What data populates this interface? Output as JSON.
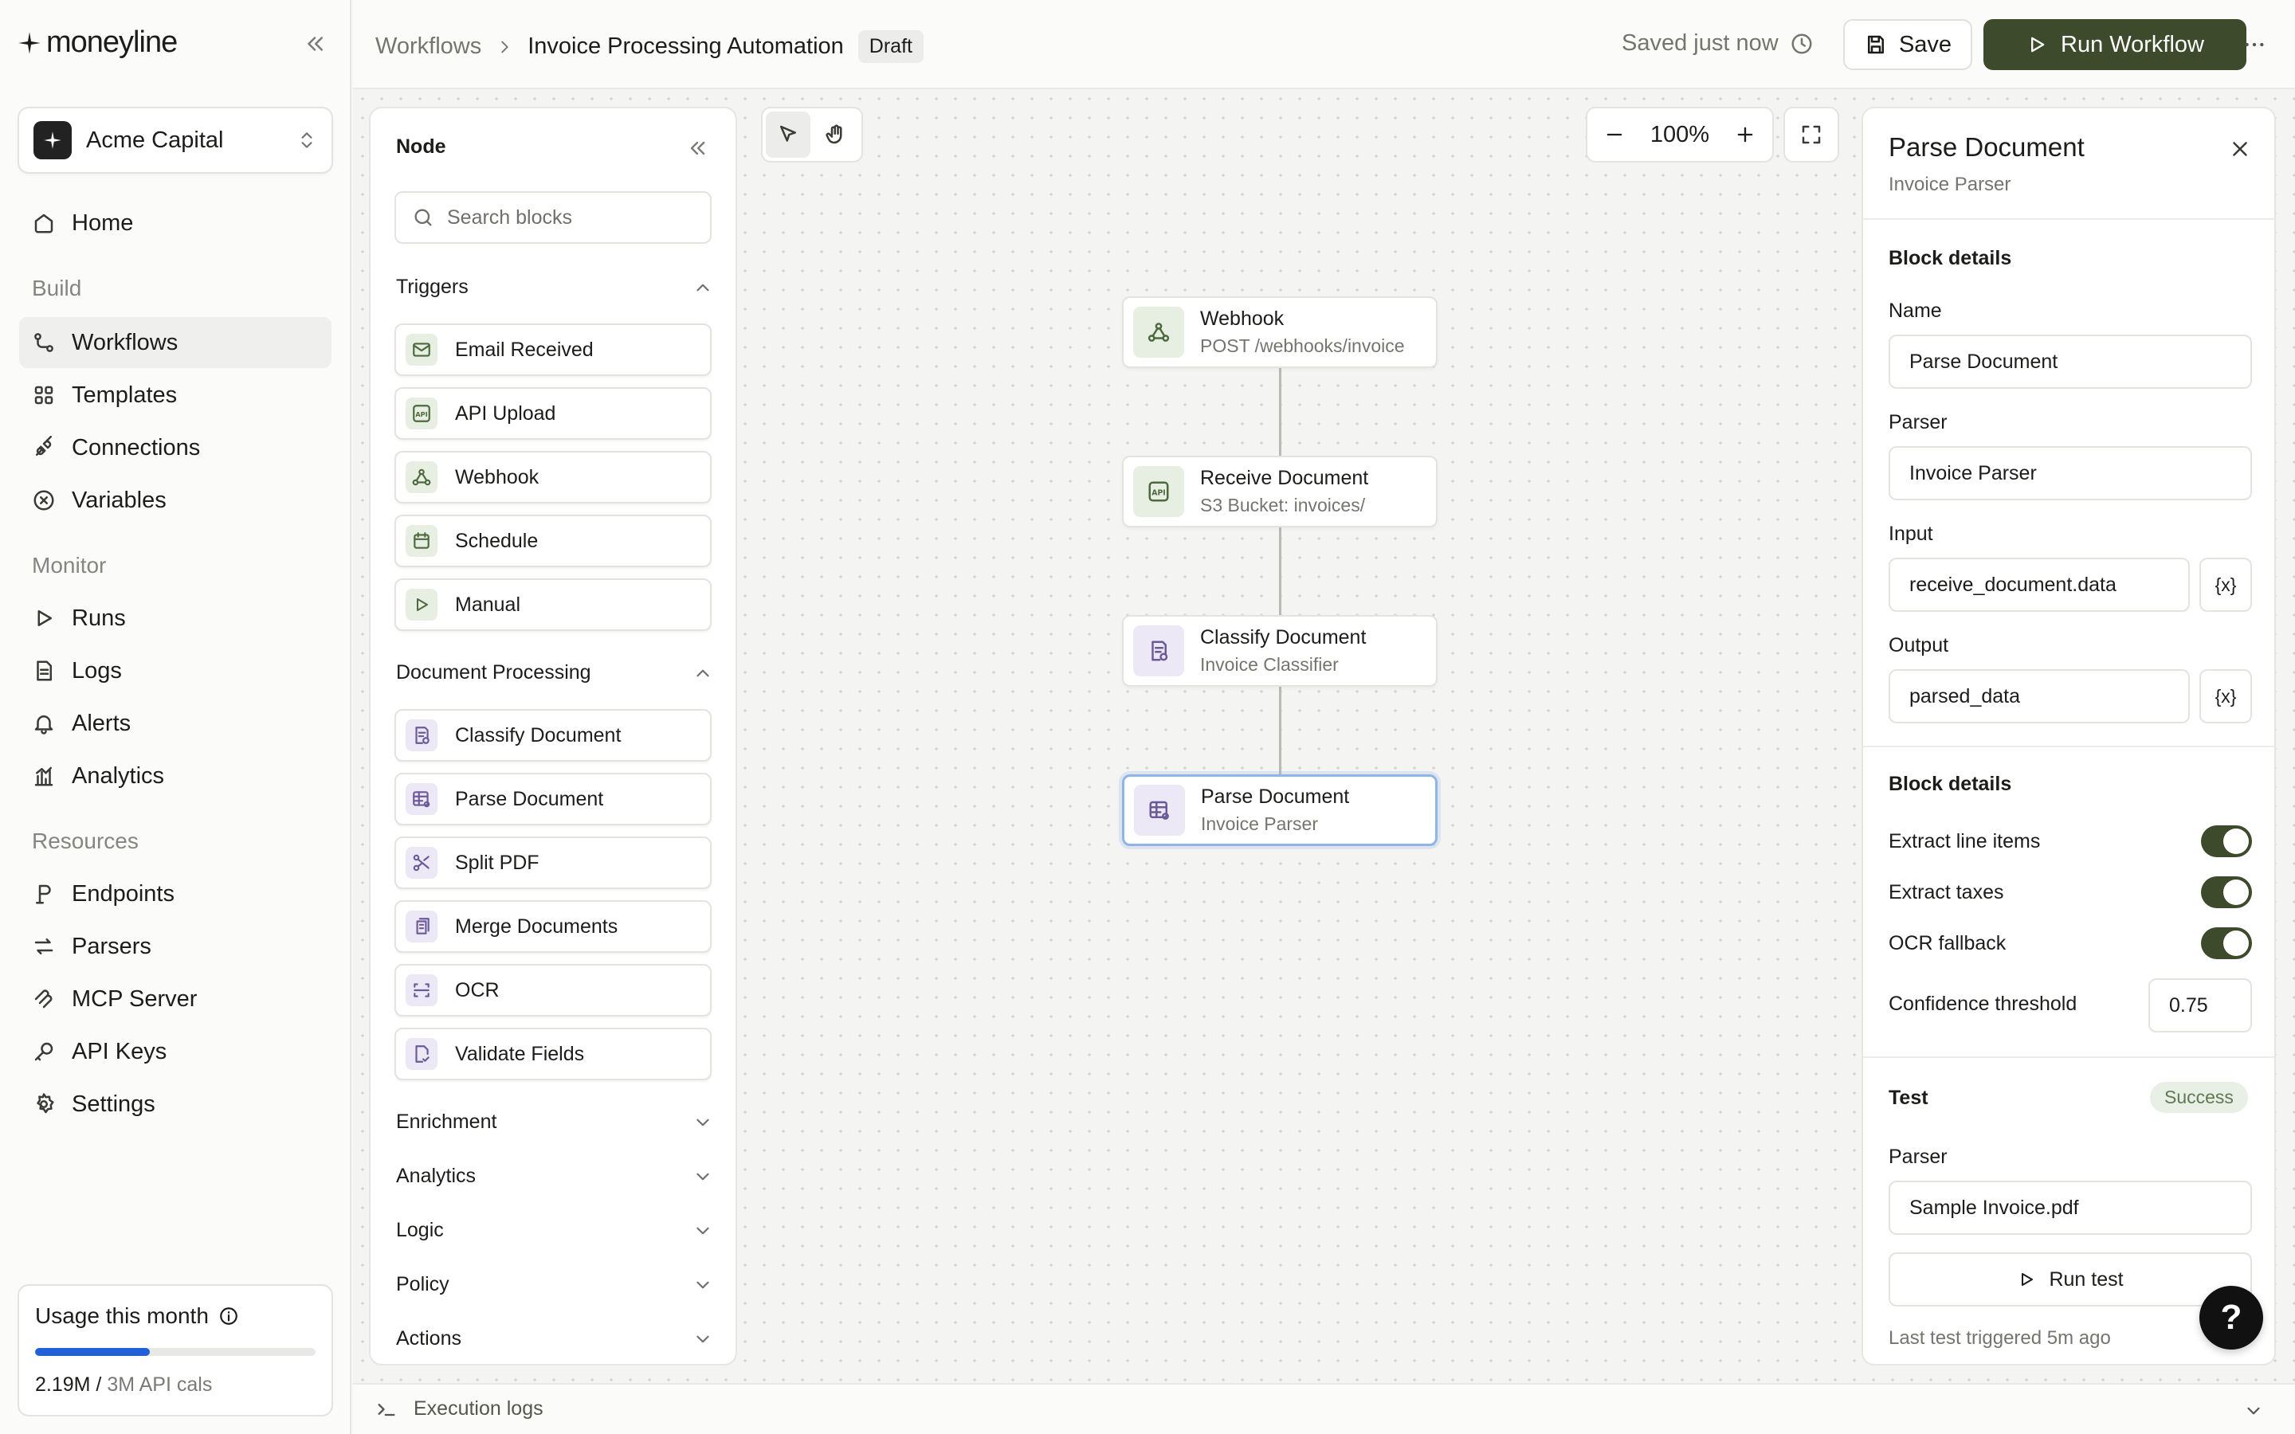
{
  "app": {
    "brand": "moneyline"
  },
  "org": {
    "name": "Acme Capital"
  },
  "nav": {
    "home": "Home",
    "sections": {
      "build": "Build",
      "monitor": "Monitor",
      "resources": "Resources"
    },
    "build": [
      "Workflows",
      "Templates",
      "Connections",
      "Variables"
    ],
    "monitor": [
      "Runs",
      "Logs",
      "Alerts",
      "Analytics"
    ],
    "resources": [
      "Endpoints",
      "Parsers",
      "MCP Server",
      "API Keys",
      "Settings"
    ],
    "active": "Workflows"
  },
  "usage": {
    "title": "Usage this month",
    "used": "2.19M",
    "separator": " / ",
    "limit": "3M API cals",
    "fraction": 0.41
  },
  "topbar": {
    "breadcrumb_root": "Workflows",
    "breadcrumb_current": "Invoice Processing Automation",
    "status_badge": "Draft",
    "saved_text": "Saved just now",
    "save_label": "Save",
    "run_label": "Run Workflow"
  },
  "node_panel": {
    "title": "Node",
    "search_placeholder": "Search blocks",
    "triggers": {
      "label": "Triggers",
      "items": [
        "Email Received",
        "API Upload",
        "Webhook",
        "Schedule",
        "Manual"
      ]
    },
    "document_processing": {
      "label": "Document Processing",
      "items": [
        "Classify Document",
        "Parse Document",
        "Split PDF",
        "Merge Documents",
        "OCR",
        "Validate Fields"
      ]
    },
    "collapsed_categories": [
      "Enrichment",
      "Analytics",
      "Logic",
      "Policy",
      "Actions"
    ]
  },
  "canvas": {
    "zoom": "100%",
    "nodes": [
      {
        "title": "Webhook",
        "subtitle": "POST /webhooks/invoice"
      },
      {
        "title": "Receive Document",
        "subtitle": "S3 Bucket: invoices/"
      },
      {
        "title": "Classify Document",
        "subtitle": "Invoice Classifier"
      },
      {
        "title": "Parse Document",
        "subtitle": "Invoice Parser"
      }
    ]
  },
  "inspector": {
    "title": "Parse Document",
    "subtitle": "Invoice Parser",
    "section1": "Block details",
    "name_label": "Name",
    "name_value": "Parse Document",
    "parser_label": "Parser",
    "parser_value": "Invoice Parser",
    "input_label": "Input",
    "input_value": "receive_document.data",
    "output_label": "Output",
    "output_value": "parsed_data",
    "var_button": "{x}",
    "section2": "Block details",
    "toggles": [
      {
        "label": "Extract line items",
        "on": true
      },
      {
        "label": "Extract taxes",
        "on": true
      },
      {
        "label": "OCR fallback",
        "on": true
      }
    ],
    "threshold_label": "Confidence threshold",
    "threshold_value": "0.75",
    "test_title": "Test",
    "test_status": "Success",
    "test_parser_label": "Parser",
    "test_parser_value": "Sample Invoice.pdf",
    "run_test_label": "Run test",
    "last_test": "Last test triggered 5m ago"
  },
  "help": "?",
  "bottom": {
    "execution_logs": "Execution logs"
  },
  "colors": {
    "accent_green": "#3d4a2c",
    "progress_blue": "#2360d8",
    "selection_blue": "#8fb4e6"
  }
}
